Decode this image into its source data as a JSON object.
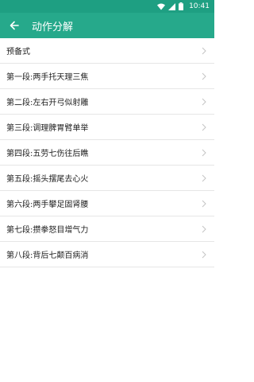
{
  "status_bar": {
    "time": "10:41",
    "icons": [
      "wifi-icon",
      "signal-icon",
      "battery-icon"
    ]
  },
  "app_bar": {
    "title": "动作分解",
    "back_icon": "arrow-left-icon",
    "color": "#26a98b"
  },
  "list": {
    "items": [
      {
        "label": "预备式"
      },
      {
        "label": "第一段:两手托天理三焦"
      },
      {
        "label": "第二段:左右开弓似射雕"
      },
      {
        "label": "第三段:调理脾胃臂单举"
      },
      {
        "label": "第四段:五劳七伤往后瞧"
      },
      {
        "label": "第五段:摇头摆尾去心火"
      },
      {
        "label": "第六段:两手攀足固肾腰"
      },
      {
        "label": "第七段:攒拳怒目增气力"
      },
      {
        "label": "第八段:背后七颠百病消"
      }
    ],
    "chevron_icon": "chevron-right-icon"
  }
}
